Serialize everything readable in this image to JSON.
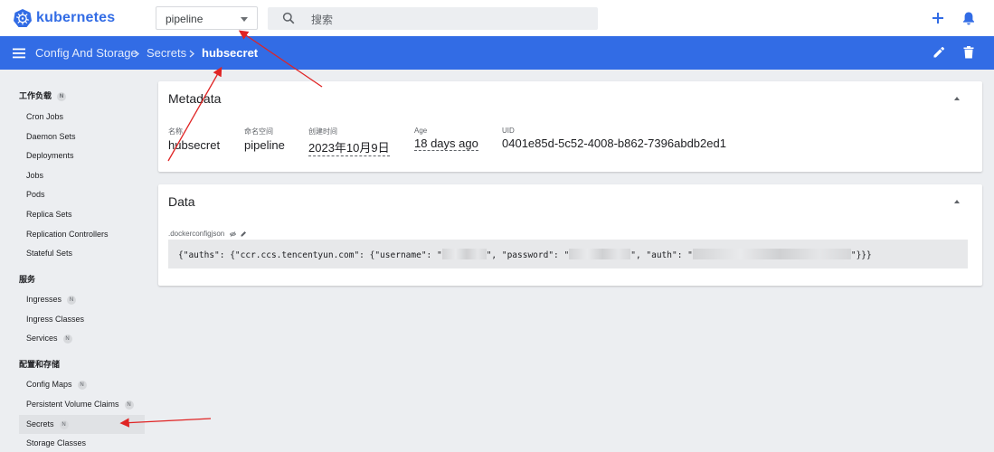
{
  "app": {
    "brand": "kubernetes"
  },
  "topbar": {
    "namespace_value": "pipeline",
    "search_placeholder": "搜索"
  },
  "breadcrumb": {
    "items": [
      "Config And Storage",
      "Secrets",
      "hubsecret"
    ]
  },
  "sidebar": {
    "sections": [
      {
        "title": "工作负载",
        "badge": "N",
        "items": [
          {
            "label": "Cron Jobs"
          },
          {
            "label": "Daemon Sets"
          },
          {
            "label": "Deployments"
          },
          {
            "label": "Jobs"
          },
          {
            "label": "Pods"
          },
          {
            "label": "Replica Sets"
          },
          {
            "label": "Replication Controllers"
          },
          {
            "label": "Stateful Sets"
          }
        ]
      },
      {
        "title": "服务",
        "items": [
          {
            "label": "Ingresses",
            "badge": "N"
          },
          {
            "label": "Ingress Classes"
          },
          {
            "label": "Services",
            "badge": "N"
          }
        ]
      },
      {
        "title": "配置和存储",
        "items": [
          {
            "label": "Config Maps",
            "badge": "N"
          },
          {
            "label": "Persistent Volume Claims",
            "badge": "N"
          },
          {
            "label": "Secrets",
            "badge": "N",
            "active": true
          },
          {
            "label": "Storage Classes"
          }
        ]
      }
    ]
  },
  "metadata": {
    "title": "Metadata",
    "fields": [
      {
        "label": "名称",
        "value": "hubsecret"
      },
      {
        "label": "命名空间",
        "value": "pipeline"
      },
      {
        "label": "创建时间",
        "value": "2023年10月9日"
      },
      {
        "label": "Age",
        "value": "18 days ago"
      },
      {
        "label": "UID",
        "value": "0401e85d-5c52-4008-b862-7396abdb2ed1"
      }
    ]
  },
  "data_card": {
    "title": "Data",
    "key": ".dockerconfigjson",
    "value_parts": {
      "p1": "{\"auths\": {\"ccr.ccs.tencentyun.com\": {\"username\": \"",
      "p2": "\", \"password\": \"",
      "p3": "\", \"auth\": \"",
      "p4": "\"}}}"
    }
  },
  "colors": {
    "brand_blue": "#326ce5",
    "annotation_red": "#e02424"
  },
  "icons": {
    "topbar": [
      "kubernetes-logo",
      "chevron-down-icon",
      "search-icon",
      "add-icon",
      "bell-icon"
    ],
    "header": [
      "menu-icon",
      "edit-icon",
      "delete-icon"
    ],
    "data": [
      "eye-off-icon",
      "pencil-icon"
    ]
  }
}
